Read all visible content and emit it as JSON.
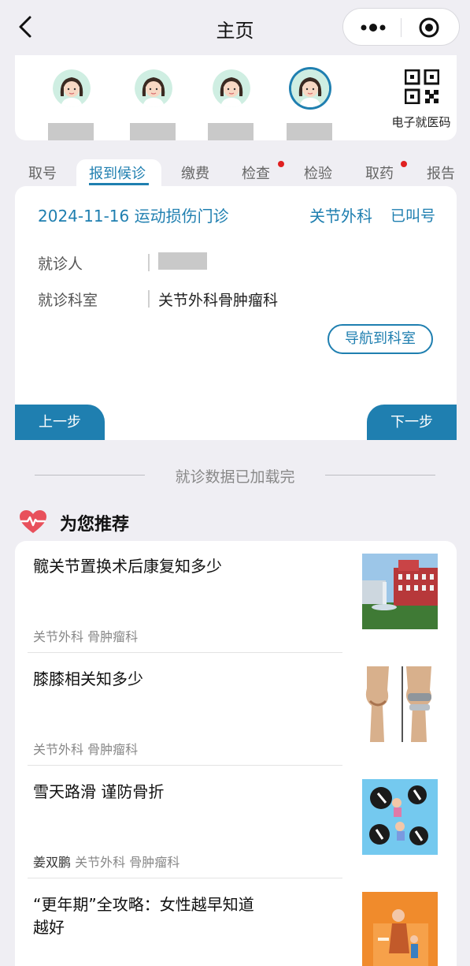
{
  "header": {
    "title": "主页"
  },
  "patients": {
    "count_shown": 4,
    "selected_index": 3,
    "qr_label": "电子就医码"
  },
  "tabs": [
    {
      "label": "取号",
      "active": false,
      "badge": false
    },
    {
      "label": "报到候诊",
      "active": true,
      "badge": false
    },
    {
      "label": "缴费",
      "active": false,
      "badge": false
    },
    {
      "label": "检查",
      "active": false,
      "badge": true
    },
    {
      "label": "检验",
      "active": false,
      "badge": false
    },
    {
      "label": "取药",
      "active": false,
      "badge": true
    },
    {
      "label": "报告",
      "active": false,
      "badge": false
    }
  ],
  "queue": {
    "date_clinic": "2024-11-16  运动损伤门诊",
    "department_short": "关节外科",
    "status": "已叫号",
    "patient_label": "就诊人",
    "dept_label": "就诊科室",
    "dept_value": "关节外科骨肿瘤科",
    "navigate_label": "导航到科室",
    "prev_label": "上一步",
    "next_label": "下一步"
  },
  "loaded_text": "就诊数据已加载完",
  "recommend": {
    "title": "为您推荐",
    "articles": [
      {
        "title": "髋关节置换术后康复知多少",
        "author": "",
        "tags": "关节外科 骨肿瘤科"
      },
      {
        "title": "膝膝相关知多少",
        "author": "",
        "tags": "关节外科 骨肿瘤科"
      },
      {
        "title": "雪天路滑 谨防骨折",
        "author": "姜双鹏",
        "tags": "关节外科 骨肿瘤科"
      },
      {
        "title": "“更年期”全攻略：女性越早知道越好",
        "author": "",
        "tags": ""
      }
    ]
  },
  "colors": {
    "accent": "#1f7fb0",
    "badge": "#e02020",
    "heart": "#e8505b"
  }
}
